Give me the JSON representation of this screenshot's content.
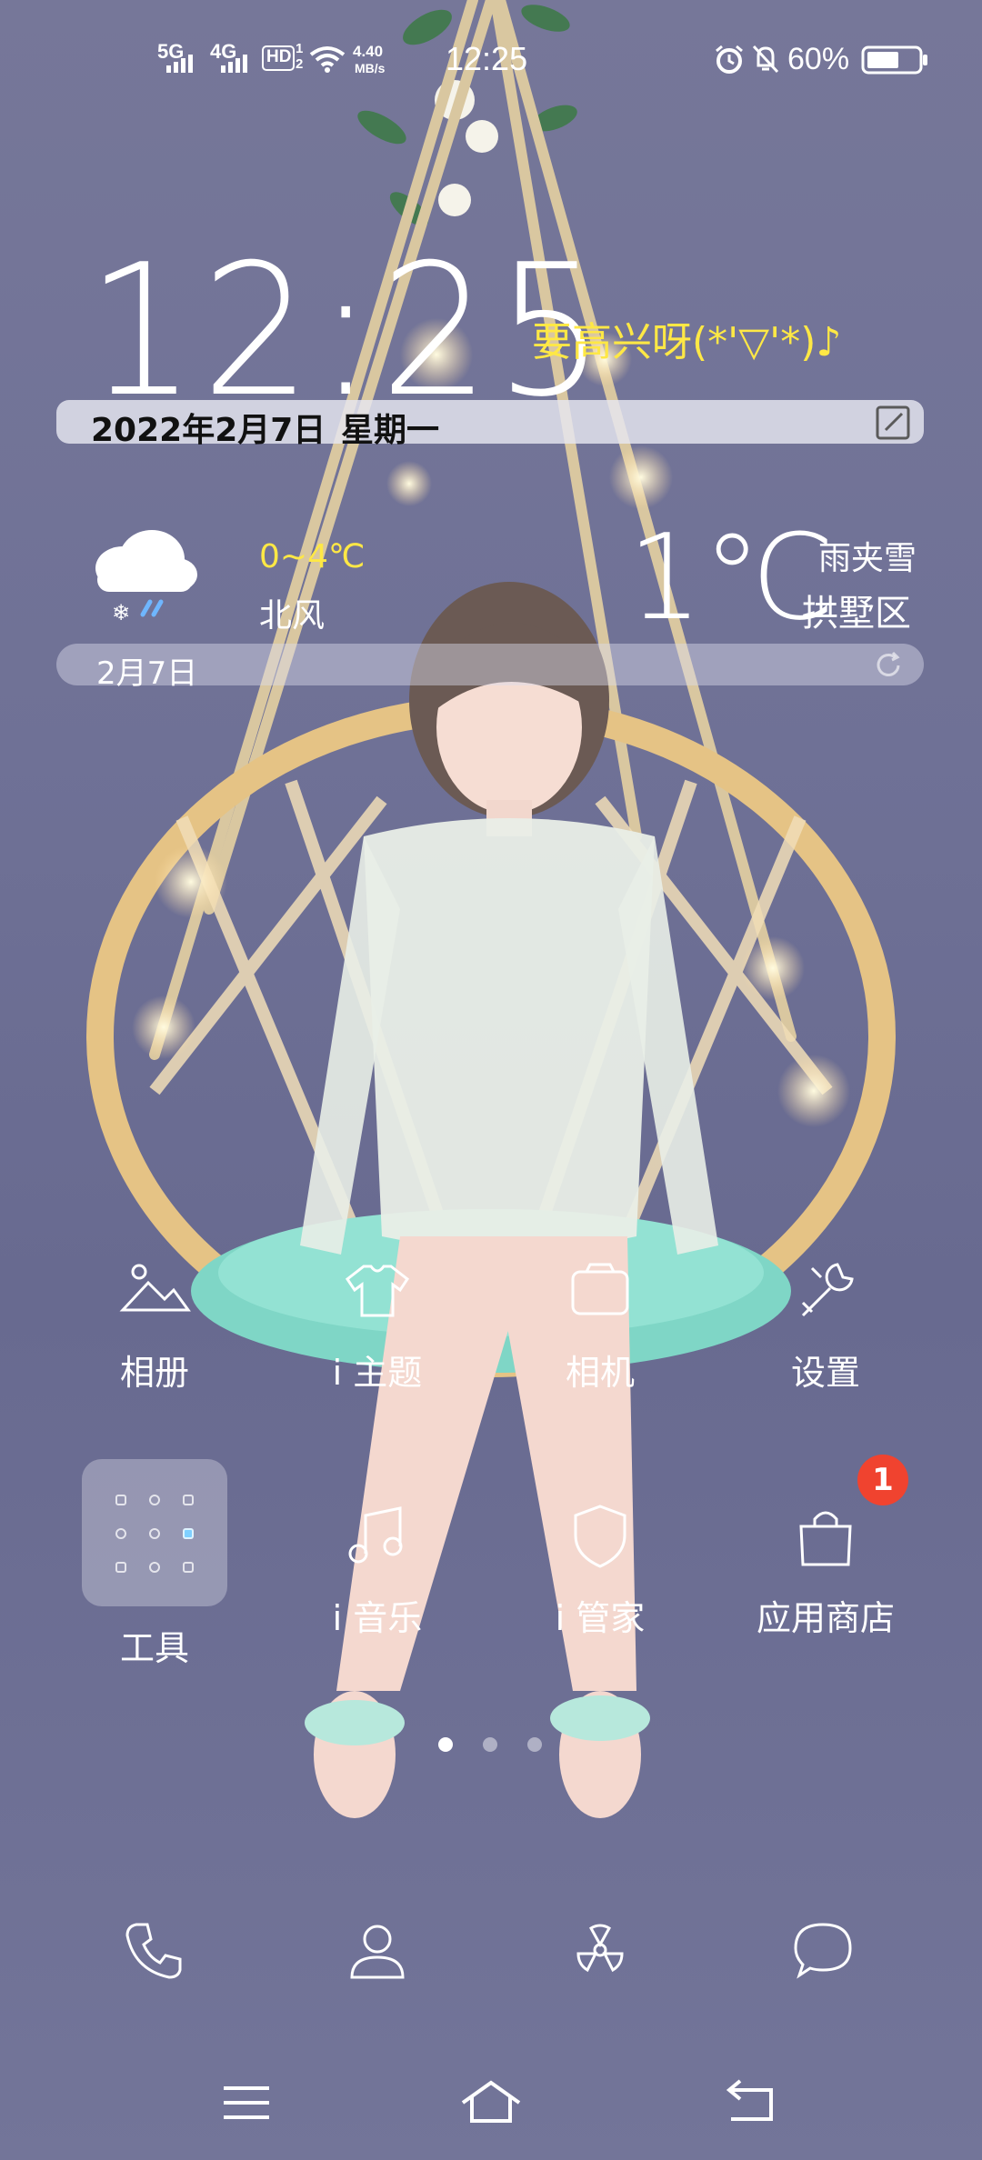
{
  "status_bar": {
    "signal_1": "5G",
    "signal_2": "4G",
    "hd_label": "HD",
    "hd_sub_1": "1",
    "hd_sub_2": "2",
    "net_speed_value": "4.40",
    "net_speed_unit": "MB/s",
    "time": "12:25",
    "battery": "60%"
  },
  "clock_widget": {
    "time": "12:25",
    "motto": "要高兴呀(*'▽'*)♪",
    "date": "2022年2月7日",
    "weekday": "星期一"
  },
  "weather_widget": {
    "temp_range": "0~4℃",
    "wind": "北风",
    "temp_now": "1℃",
    "condition": "雨夹雪",
    "district": "拱墅区",
    "date": "2月7日"
  },
  "apps": {
    "row1": [
      {
        "label": "相册",
        "icon": "photos-icon"
      },
      {
        "label": "i 主题",
        "icon": "theme-icon"
      },
      {
        "label": "相机",
        "icon": "camera-icon"
      },
      {
        "label": "设置",
        "icon": "settings-icon"
      }
    ],
    "row2": [
      {
        "label": "工具",
        "icon": "tools-folder-icon"
      },
      {
        "label": "i 音乐",
        "icon": "music-icon"
      },
      {
        "label": "i 管家",
        "icon": "shield-icon"
      },
      {
        "label": "应用商店",
        "icon": "app-store-icon"
      }
    ],
    "app_store_badge": "1"
  },
  "page_indicator": {
    "pages": 3,
    "active": 1
  },
  "dock": [
    "phone-icon",
    "contacts-icon",
    "browser-icon",
    "messages-icon"
  ],
  "nav_bar": [
    "menu-icon",
    "home-icon",
    "back-icon"
  ]
}
